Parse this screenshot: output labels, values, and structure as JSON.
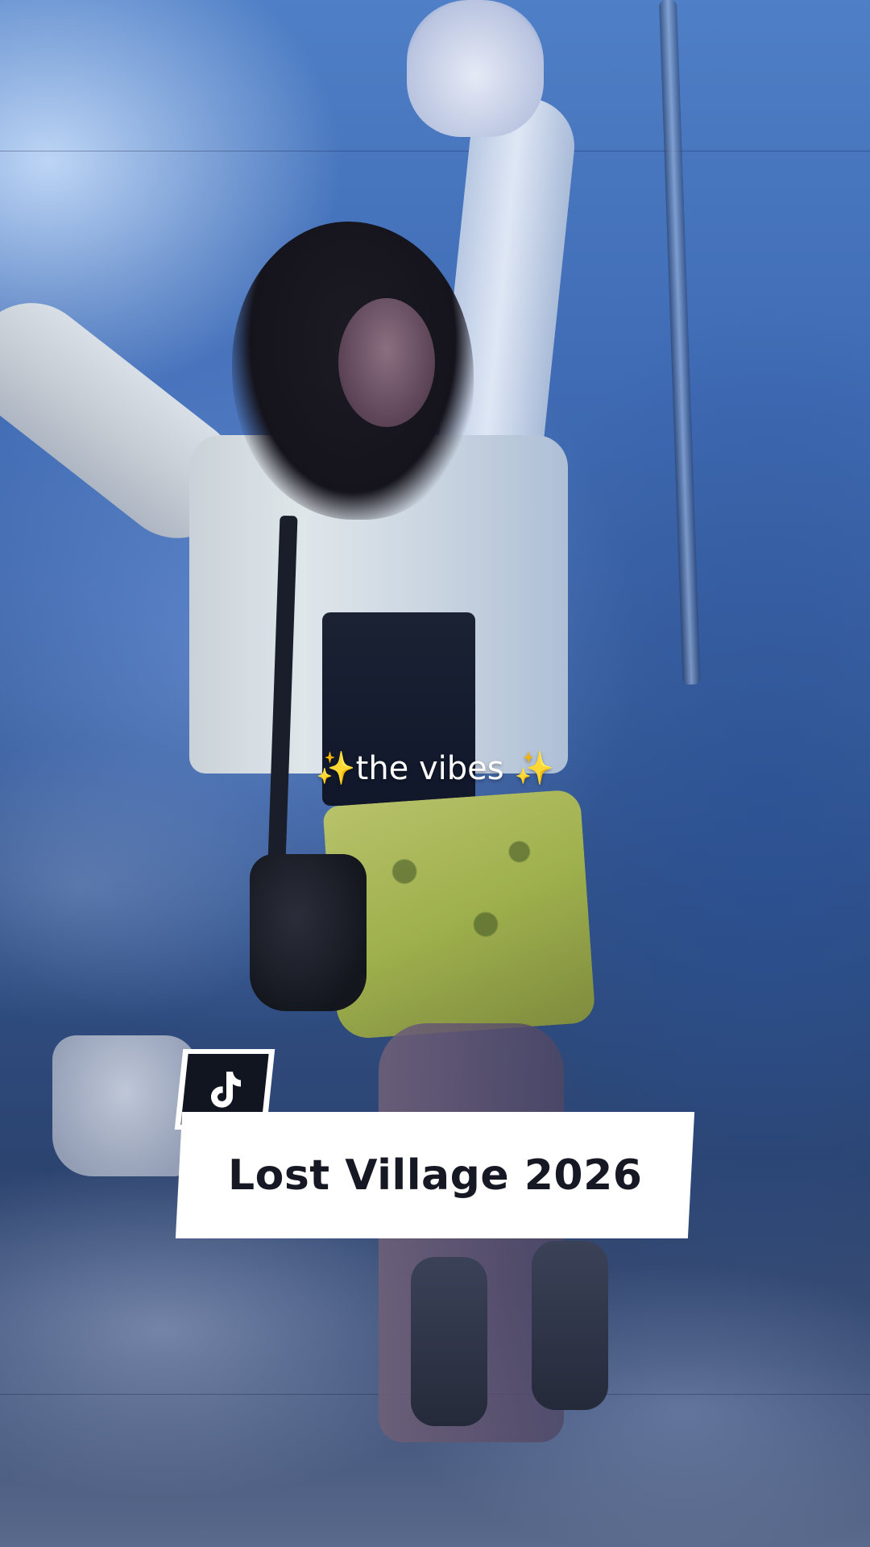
{
  "video": {
    "caption": {
      "sparkle_left": "✨",
      "text": "the vibes",
      "sparkle_right": "✨"
    },
    "title_card": {
      "title": "Lost Village 2026"
    },
    "icons": {
      "logo": "tiktok-logo-icon"
    },
    "colors": {
      "card_bg": "#ffffff",
      "logo_bg": "#111520",
      "title_text": "#161823",
      "sparkle": "#f4c542"
    }
  }
}
